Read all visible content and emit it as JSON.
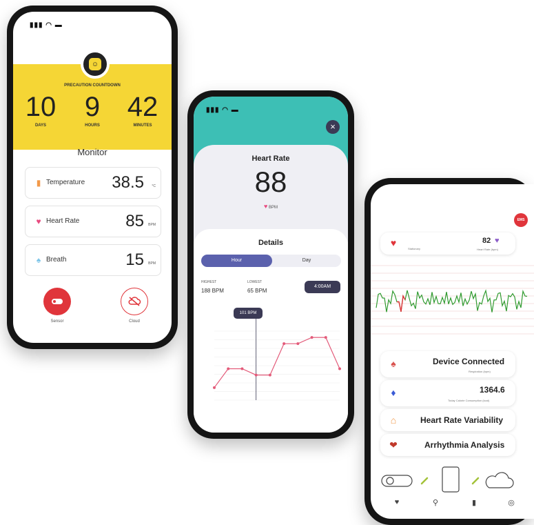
{
  "phone1": {
    "countdown": {
      "title": "PRECAUTION COUNTDOWN",
      "days_value": "10",
      "days_label": "DAYS",
      "hours_value": "9",
      "hours_label": "HOURS",
      "minutes_value": "42",
      "minutes_label": "MINUTES"
    },
    "monitor_title": "Monitor",
    "metrics": [
      {
        "label": "Temperature",
        "value": "38.5",
        "unit": "°C",
        "icon": "thermometer-icon"
      },
      {
        "label": "Heart Rate",
        "value": "85",
        "unit": "BPM",
        "icon": "heart-icon"
      },
      {
        "label": "Breath",
        "value": "15",
        "unit": "BPM",
        "icon": "lungs-icon"
      }
    ],
    "buttons": [
      {
        "label": "Sensor",
        "icon": "sensor-icon"
      },
      {
        "label": "Cloud",
        "icon": "cloud-off-icon"
      }
    ],
    "colors": {
      "accent": "#f5d635",
      "danger": "#e0353b"
    }
  },
  "phone2": {
    "heart_rate_title": "Heart Rate",
    "heart_rate_value": "88",
    "heart_rate_unit": "BPM",
    "details_title": "Details",
    "tabs": [
      "Hour",
      "Day"
    ],
    "active_tab": "Hour",
    "highest_label": "HIGHEST",
    "highest_value": "188 BPM",
    "lowest_label": "LOWEST",
    "lowest_value": "65 BPM",
    "time_button": "4:00AM",
    "tooltip": "101 BPM",
    "colors": {
      "accent": "#3dbfb5",
      "tab": "#5b61ad",
      "line": "#e35b7a"
    },
    "chart_data": {
      "type": "line",
      "x": [
        1,
        2,
        3,
        4,
        5,
        6,
        7,
        8,
        9,
        10
      ],
      "series": [
        {
          "values": [
            80,
            110,
            110,
            100,
            100,
            150,
            150,
            160,
            160,
            110
          ]
        }
      ]
    }
  },
  "phone3": {
    "logo": "EMS",
    "summary_left_label": "Stationary",
    "summary_value": "82",
    "summary_right_label": "Heart Rate (bpm)",
    "device_status": "Device Connected",
    "device_sub": "Respiration (bpm)",
    "calories_value": "1364.6",
    "calories_label": "Today Calorie Consumption (kcal)",
    "hrv_label": "Heart Rate Variability",
    "arrhythmia_label": "Arrhythmia Analysis",
    "colors": {
      "ecg": "#2e9a2e",
      "ecg_alert": "#e0353b"
    }
  }
}
